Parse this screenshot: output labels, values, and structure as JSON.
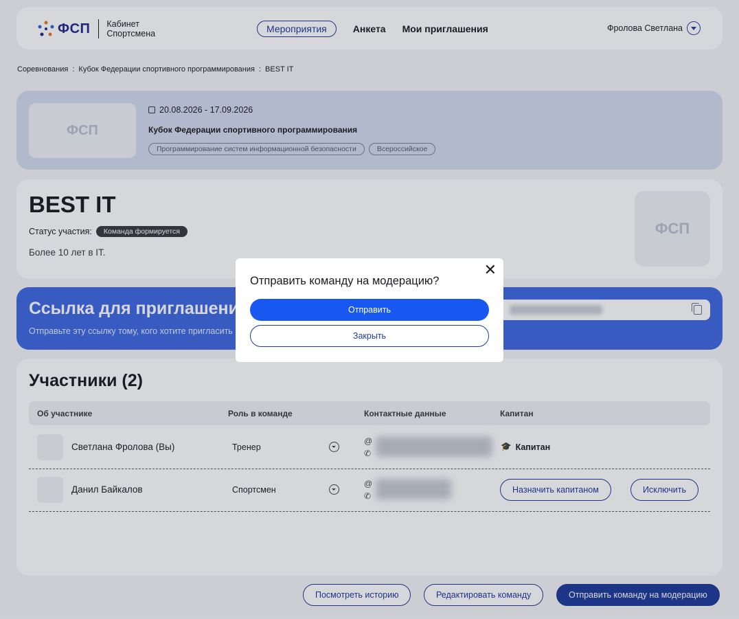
{
  "header": {
    "logo_text": "ФСП",
    "logo_sub_line1": "Кабинет",
    "logo_sub_line2": "Спортсмена",
    "nav": [
      "Мероприятия",
      "Анкета",
      "Мои приглашения"
    ],
    "user_name": "Фролова Светлана"
  },
  "breadcrumb": [
    "Соревнования",
    ":",
    "Кубок Федерации спортивного программирования",
    ":",
    "BEST IT"
  ],
  "event": {
    "logo_text": "ФСП",
    "dates": "20.08.2026 - 17.09.2026",
    "title": "Кубок Федерации спортивного программирования",
    "tags": [
      "Программирование систем информационной безопасности",
      "Всероссийское"
    ]
  },
  "team": {
    "name": "BEST IT",
    "status_label": "Статус участия:",
    "status_value": "Команда формируется",
    "description": "Более 10 лет в IT.",
    "logo_text": "ФСП"
  },
  "invite": {
    "title": "Ссылка для приглашения",
    "subtitle": "Отправьте эту ссылку тому, кого хотите пригласить"
  },
  "participants": {
    "title": "Участники (2)",
    "columns": [
      "Об участнике",
      "Роль в команде",
      "Контактные данные",
      "Капитан"
    ],
    "rows": [
      {
        "name": "Светлана Фролова (Вы)",
        "role": "Тренер",
        "captain": "Капитан"
      },
      {
        "name": "Данил Байкалов",
        "role": "Спортсмен",
        "assign_captain": "Назначить капитаном",
        "exclude": "Исключить"
      }
    ]
  },
  "footer_buttons": {
    "history": "Посмотреть историю",
    "edit": "Редактировать команду",
    "send": "Отправить команду на модерацию"
  },
  "modal": {
    "title": "Отправить команду на модерацию?",
    "primary": "Отправить",
    "secondary": "Закрыть",
    "close_symbol": "✕"
  },
  "colors": {
    "accent": "#1857f0",
    "dark_blue": "#1e3a9a",
    "invite_bg": "#3e68e0"
  }
}
